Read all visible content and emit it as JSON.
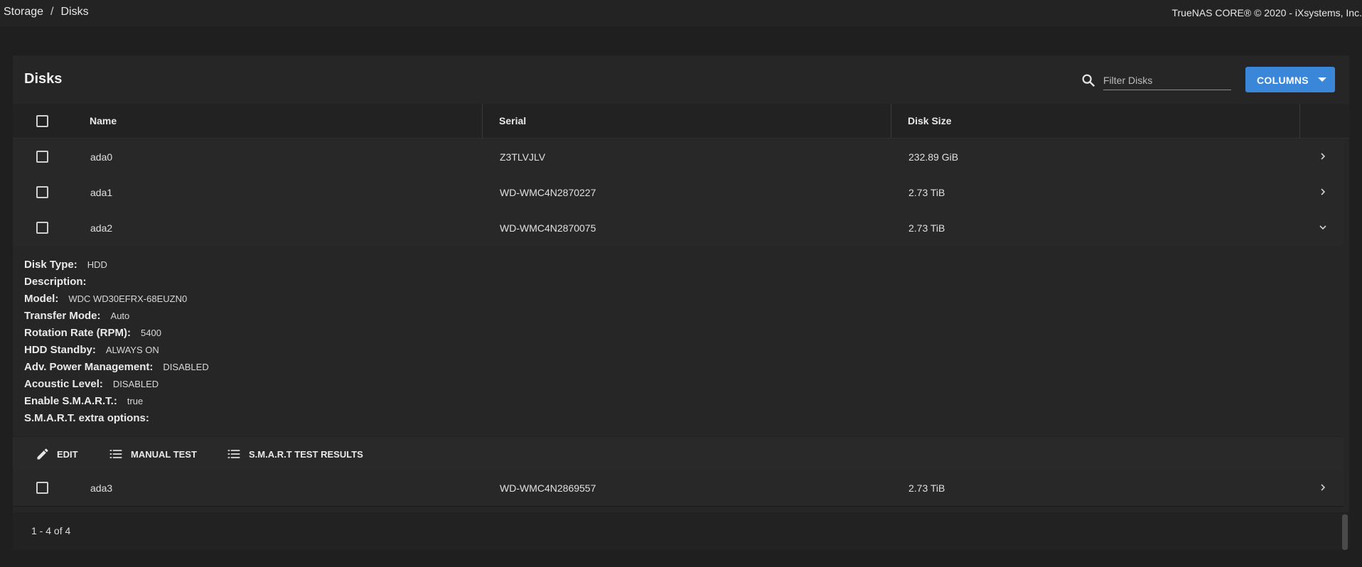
{
  "breadcrumb": {
    "parent": "Storage",
    "separator": "/",
    "current": "Disks"
  },
  "copyright": "TrueNAS CORE® © 2020 - iXsystems, Inc.",
  "card": {
    "title": "Disks",
    "search": {
      "placeholder": "Filter Disks",
      "value": ""
    },
    "columns_button": "COLUMNS"
  },
  "table": {
    "headers": [
      "Name",
      "Serial",
      "Disk Size"
    ],
    "rows": [
      {
        "name": "ada0",
        "serial": "Z3TLVJLV",
        "size": "232.89 GiB",
        "expanded": false
      },
      {
        "name": "ada1",
        "serial": "WD-WMC4N2870227",
        "size": "2.73 TiB",
        "expanded": false
      },
      {
        "name": "ada2",
        "serial": "WD-WMC4N2870075",
        "size": "2.73 TiB",
        "expanded": true
      },
      {
        "name": "ada3",
        "serial": "WD-WMC4N2869557",
        "size": "2.73 TiB",
        "expanded": false
      }
    ]
  },
  "details": [
    {
      "label": "Disk Type:",
      "value": "HDD"
    },
    {
      "label": "Description:",
      "value": ""
    },
    {
      "label": "Model:",
      "value": "WDC WD30EFRX-68EUZN0"
    },
    {
      "label": "Transfer Mode:",
      "value": "Auto"
    },
    {
      "label": "Rotation Rate (RPM):",
      "value": "5400"
    },
    {
      "label": "HDD Standby:",
      "value": "ALWAYS ON"
    },
    {
      "label": "Adv. Power Management:",
      "value": "DISABLED"
    },
    {
      "label": "Acoustic Level:",
      "value": "DISABLED"
    },
    {
      "label": "Enable S.M.A.R.T.:",
      "value": "true"
    },
    {
      "label": "S.M.A.R.T. extra options:",
      "value": ""
    }
  ],
  "actions": {
    "edit": "EDIT",
    "manual_test": "MANUAL TEST",
    "smart_results": "S.M.A.R.T TEST RESULTS"
  },
  "footer": {
    "pagination": "1 - 4 of 4"
  },
  "colors": {
    "accent": "#3a86d8",
    "background": "#1f1f1f",
    "card": "#262626"
  }
}
